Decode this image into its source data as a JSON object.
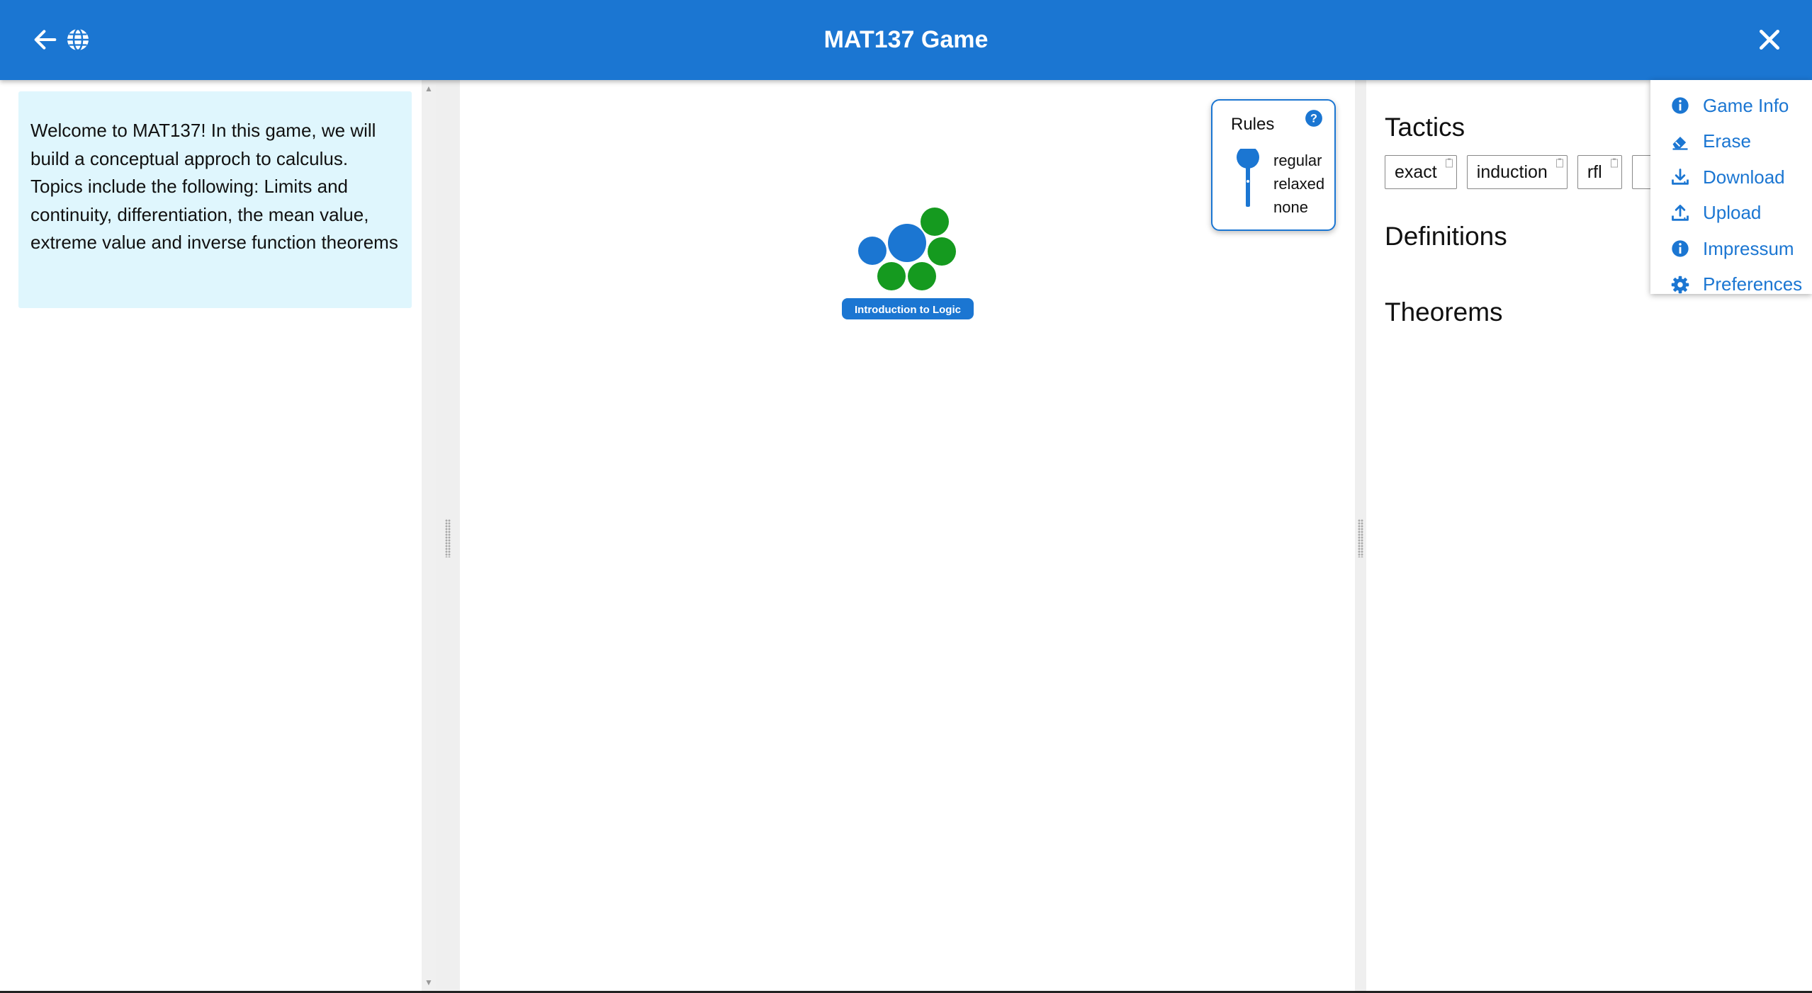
{
  "header": {
    "title": "MAT137 Game",
    "back_icon": "arrow-left-icon",
    "language_icon": "globe-icon",
    "close_icon": "close-icon",
    "bg_color": "#1b76d2"
  },
  "intro": {
    "text": "Welcome to MAT137! In this game, we will build a conceptual approch to calculus. Topics include the following: Limits and continuity, differentiation, the mean value, extreme value and inverse function theorems",
    "bg_color": "#dff6fd"
  },
  "world": {
    "world_label": "Introduction to Logic",
    "world_color": "#1b76d2",
    "solved_color": "#159a1f"
  },
  "rules": {
    "title": "Rules",
    "options": [
      "regular",
      "relaxed",
      "none"
    ],
    "selected": "regular"
  },
  "inventory": {
    "tactics_heading": "Tactics",
    "tactics": [
      {
        "label": "exact"
      },
      {
        "label": "induction"
      },
      {
        "label": "rfl"
      }
    ],
    "definitions_heading": "Definitions",
    "theorems_heading": "Theorems"
  },
  "menu": {
    "items": [
      {
        "label": "Game Info",
        "icon": "info-circle-icon"
      },
      {
        "label": "Erase",
        "icon": "eraser-icon"
      },
      {
        "label": "Download",
        "icon": "download-icon"
      },
      {
        "label": "Upload",
        "icon": "upload-icon"
      },
      {
        "label": "Impressum",
        "icon": "info-circle-icon"
      },
      {
        "label": "Preferences",
        "icon": "gear-icon"
      }
    ]
  }
}
